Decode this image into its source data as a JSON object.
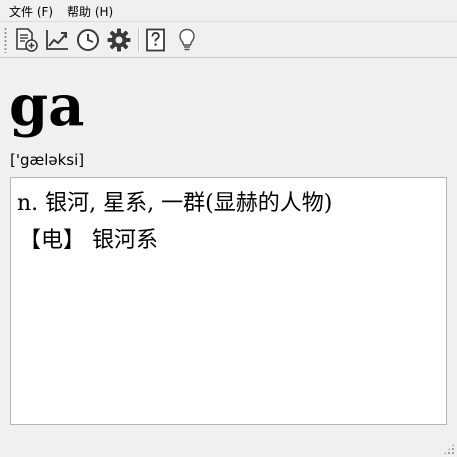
{
  "menu": {
    "file_label": "文件 (F)",
    "help_label": "帮助 (H)"
  },
  "toolbar": {
    "buttons": [
      {
        "name": "add-document",
        "icon": "add-document-icon"
      },
      {
        "name": "statistics",
        "icon": "line-chart-icon"
      },
      {
        "name": "history",
        "icon": "clock-icon"
      },
      {
        "name": "settings",
        "icon": "gear-icon"
      },
      {
        "name": "help",
        "icon": "question-mark-icon"
      },
      {
        "name": "tips",
        "icon": "lightbulb-icon"
      }
    ]
  },
  "entry": {
    "headword": "ga",
    "phonetic": "['gæləksi]",
    "definitions": [
      "n. 银河, 星系, 一群(显赫的人物)",
      "【电】 银河系"
    ]
  },
  "colors": {
    "window_bg": "#f0f0f0",
    "panel_bg": "#ffffff",
    "icon_stroke": "#3a3a3a",
    "icon_accent_green": "#2f9e3a"
  }
}
